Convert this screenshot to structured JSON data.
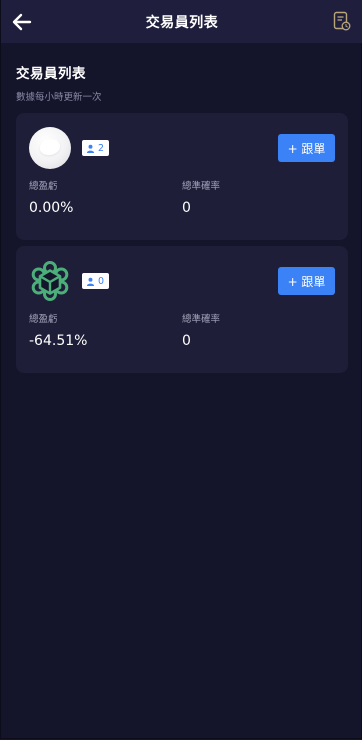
{
  "header": {
    "title": "交易員列表",
    "back_icon": "arrow-left-icon",
    "right_icon": "document-clock-icon"
  },
  "section": {
    "title": "交易員列表",
    "subtitle": "數據每小時更新一次"
  },
  "traders": [
    {
      "avatar": "white-circle-avatar",
      "followers": "2",
      "follow_label": "+ 跟單",
      "stats": [
        {
          "label": "總盈虧",
          "value": "0.00%"
        },
        {
          "label": "總準確率",
          "value": "0"
        }
      ]
    },
    {
      "avatar": "green-hexagon-logo",
      "followers": "0",
      "follow_label": "+ 跟單",
      "stats": [
        {
          "label": "總盈虧",
          "value": "-64.51%"
        },
        {
          "label": "總準確率",
          "value": "0"
        }
      ]
    }
  ],
  "colors": {
    "background": "#14142b",
    "topbar": "#1f1f3d",
    "card": "#1e1e38",
    "accent": "#3b82f6",
    "logo_green": "#4caf7a"
  }
}
